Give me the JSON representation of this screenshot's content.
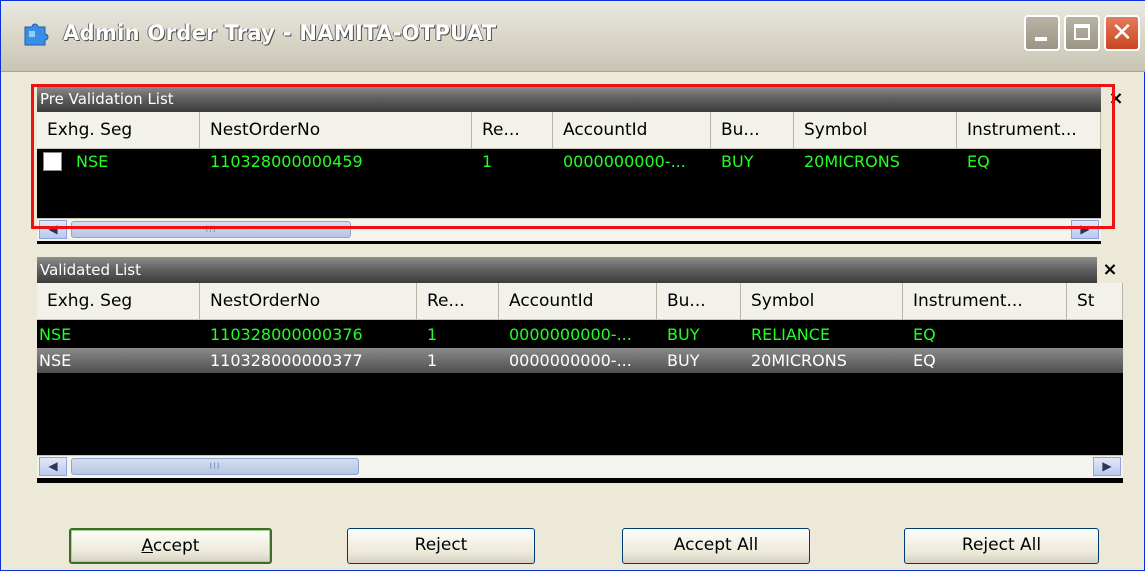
{
  "window": {
    "title": "Admin Order Tray - NAMITA-OTPUAT",
    "icons": {
      "app": "puzzle-piece-icon",
      "minimize": "minimize-icon",
      "maximize": "maximize-icon",
      "close": "close-icon"
    }
  },
  "pre_validation": {
    "header": "Pre Validation List",
    "close_label": "×",
    "columns": [
      "Exhg. Seg",
      "NestOrderNo",
      "Re...",
      "AccountId",
      "Bu...",
      "Symbol",
      "Instrument..."
    ],
    "rows": [
      {
        "seg": "NSE",
        "order_no": "110328000000459",
        "re": "1",
        "account": "0000000000-...",
        "bu": "BUY",
        "symbol": "20MICRONS",
        "instrument": "EQ",
        "checked": false
      }
    ],
    "row_color": "#22ff22",
    "scroll_grip": "III"
  },
  "validated": {
    "header": "Validated List",
    "close_label": "×",
    "columns": [
      "Exhg. Seg",
      "NestOrderNo",
      "Re...",
      "AccountId",
      "Bu...",
      "Symbol",
      "Instrument...",
      "St"
    ],
    "rows": [
      {
        "seg": "NSE",
        "order_no": "110328000000376",
        "re": "1",
        "account": "0000000000-...",
        "bu": "BUY",
        "symbol": "RELIANCE",
        "instrument": "EQ",
        "style": "green"
      },
      {
        "seg": "NSE",
        "order_no": "110328000000377",
        "re": "1",
        "account": "0000000000-...",
        "bu": "BUY",
        "symbol": "20MICRONS",
        "instrument": "EQ",
        "style": "selected"
      }
    ],
    "scroll_grip": "III"
  },
  "buttons": {
    "accept": "Accept",
    "reject": "Reject",
    "accept_all": "Accept All",
    "reject_all": "Reject All"
  },
  "colors": {
    "highlight": "#ee1111",
    "title_bar": "#d8d5c8",
    "grid_bg": "#000000"
  }
}
